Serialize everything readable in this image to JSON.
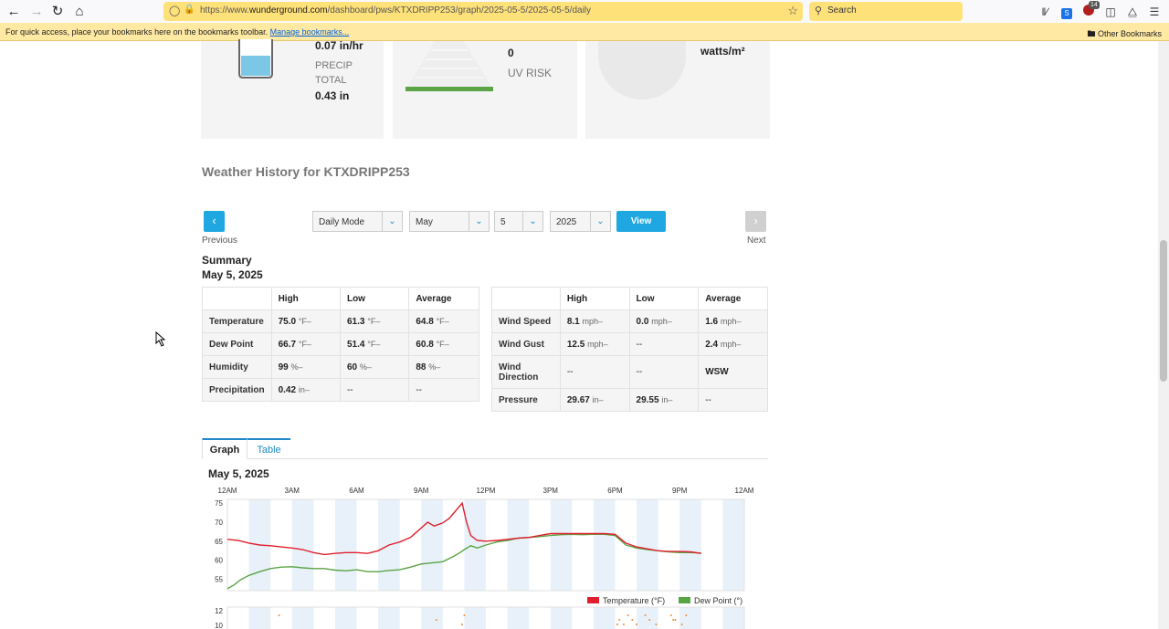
{
  "browser": {
    "url_prefix": "https://www.",
    "url_domain": "wunderground.com",
    "url_path": "/dashboard/pws/KTXDRIPP253/graph/2025-05-5/2025-05-5/daily",
    "search_placeholder": "Search",
    "bookmarks_hint": "For quick access, place your bookmarks here on the bookmarks toolbar.",
    "manage_bookmarks": "Manage bookmarks...",
    "other_bookmarks": "Other Bookmarks",
    "extension_badge": "14"
  },
  "cards": {
    "precip_rate": "0.07 in/hr",
    "precip_label_1": "PRECIP",
    "precip_label_2": "TOTAL",
    "precip_total": "0.43 in",
    "uv_value": "0",
    "uv_label": "UV RISK",
    "solar_unit": "watts/m²"
  },
  "history": {
    "title": "Weather History for KTXDRIPP253",
    "previous": "Previous",
    "next": "Next",
    "mode": "Daily Mode",
    "month": "May",
    "day": "5",
    "year": "2025",
    "view": "View"
  },
  "summary": {
    "title": "Summary",
    "date": "May 5, 2025",
    "headers": [
      "",
      "High",
      "Low",
      "Average"
    ],
    "left_rows": [
      {
        "label": "Temperature",
        "high": "75.0",
        "high_unit": "°F–",
        "low": "61.3",
        "low_unit": "°F–",
        "avg": "64.8",
        "avg_unit": "°F–"
      },
      {
        "label": "Dew Point",
        "high": "66.7",
        "high_unit": "°F–",
        "low": "51.4",
        "low_unit": "°F–",
        "avg": "60.8",
        "avg_unit": "°F–"
      },
      {
        "label": "Humidity",
        "high": "99",
        "high_unit": "%–",
        "low": "60",
        "low_unit": "%–",
        "avg": "88",
        "avg_unit": "%–"
      },
      {
        "label": "Precipitation",
        "high": "0.42",
        "high_unit": "in–",
        "low": "--",
        "low_unit": "",
        "avg": "--",
        "avg_unit": ""
      }
    ],
    "right_rows": [
      {
        "label": "Wind Speed",
        "high": "8.1",
        "high_unit": "mph–",
        "low": "0.0",
        "low_unit": "mph–",
        "avg": "1.6",
        "avg_unit": "mph–"
      },
      {
        "label": "Wind Gust",
        "high": "12.5",
        "high_unit": "mph–",
        "low": "--",
        "low_unit": "",
        "avg": "2.4",
        "avg_unit": "mph–"
      },
      {
        "label": "Wind Direction",
        "high": "--",
        "high_unit": "",
        "low": "--",
        "low_unit": "",
        "avg": "WSW",
        "avg_unit": ""
      },
      {
        "label": "Pressure",
        "high": "29.67",
        "high_unit": "in–",
        "low": "29.55",
        "low_unit": "in–",
        "avg": "--",
        "avg_unit": ""
      }
    ]
  },
  "tabs": {
    "graph": "Graph",
    "table": "Table"
  },
  "graph": {
    "title": "May 5, 2025"
  },
  "chart_data": {
    "type": "line",
    "x_tick_labels": [
      "12AM",
      "3AM",
      "6AM",
      "9AM",
      "12PM",
      "3PM",
      "6PM",
      "9PM",
      "12AM"
    ],
    "y_ticks": [
      75,
      70,
      65,
      60,
      55
    ],
    "ylim": [
      52,
      76
    ],
    "xlim": [
      0,
      24
    ],
    "second_panel_y_ticks": [
      12,
      10
    ],
    "colors": {
      "temperature": "#e0202d",
      "dew_point": "#5aa445",
      "band": "#e8f1f9",
      "precip_dot": "#f08a2c"
    },
    "series": [
      {
        "name": "Temperature (°F)",
        "x": [
          0,
          0.5,
          1,
          1.5,
          2,
          2.5,
          3,
          3.5,
          4,
          4.5,
          5,
          5.5,
          6,
          6.5,
          7,
          7.5,
          8,
          8.5,
          9,
          9.3,
          9.6,
          10,
          10.3,
          10.6,
          10.9,
          11.1,
          11.3,
          11.6,
          12,
          12.5,
          13,
          13.5,
          14,
          14.5,
          15,
          15.5,
          16,
          16.5,
          17,
          17.5,
          18,
          18.5,
          19,
          19.5,
          20,
          20.5,
          21,
          21.5,
          22
        ],
        "y": [
          65.5,
          65.2,
          64.5,
          64,
          63.8,
          63.5,
          63.2,
          62.8,
          62,
          61.5,
          61.8,
          62,
          62,
          61.8,
          62.5,
          64,
          64.8,
          66,
          68.5,
          70,
          69,
          69.8,
          71,
          73,
          75,
          70,
          66.5,
          65.2,
          65,
          65.2,
          65.5,
          65.8,
          66,
          66.5,
          67,
          67,
          67,
          67,
          67,
          67,
          66.8,
          64.5,
          63.5,
          63,
          62.5,
          62.3,
          62.3,
          62.2,
          61.8
        ]
      },
      {
        "name": "Dew Point (°)",
        "x": [
          0,
          0.3,
          0.6,
          1,
          1.5,
          2,
          2.5,
          3,
          3.5,
          4,
          4.5,
          5,
          5.5,
          6,
          6.5,
          7,
          7.5,
          8,
          8.5,
          9,
          9.5,
          10,
          10.5,
          10.8,
          11,
          11.3,
          11.6,
          12,
          12.5,
          13,
          13.5,
          14,
          14.5,
          15,
          15.5,
          16,
          16.5,
          17,
          17.5,
          18,
          18.5,
          19,
          19.5,
          20,
          20.5,
          21,
          21.5,
          22
        ],
        "y": [
          52.5,
          53.5,
          54.8,
          56,
          57,
          57.8,
          58.2,
          58.3,
          58,
          57.8,
          57.8,
          57.4,
          57.2,
          57.5,
          57,
          57,
          57.3,
          57.5,
          58.2,
          59,
          59.3,
          59.6,
          61,
          62,
          62.8,
          63.8,
          63.2,
          64,
          64.8,
          65.2,
          65.8,
          66,
          66.2,
          66.5,
          66.7,
          66.8,
          66.7,
          66.8,
          66.8,
          66.5,
          64,
          63.2,
          62.8,
          62.5,
          62.2,
          62,
          62,
          61.9
        ]
      }
    ],
    "precip_dots_x": [
      2.4,
      9.7,
      10.9,
      11.0,
      18.2,
      18.4,
      18.6,
      18.8,
      19.0,
      19.4,
      19.6,
      19.9,
      20.6,
      20.7,
      21.1,
      21.3,
      20.8,
      18.1
    ],
    "legend": "bottom-right"
  }
}
